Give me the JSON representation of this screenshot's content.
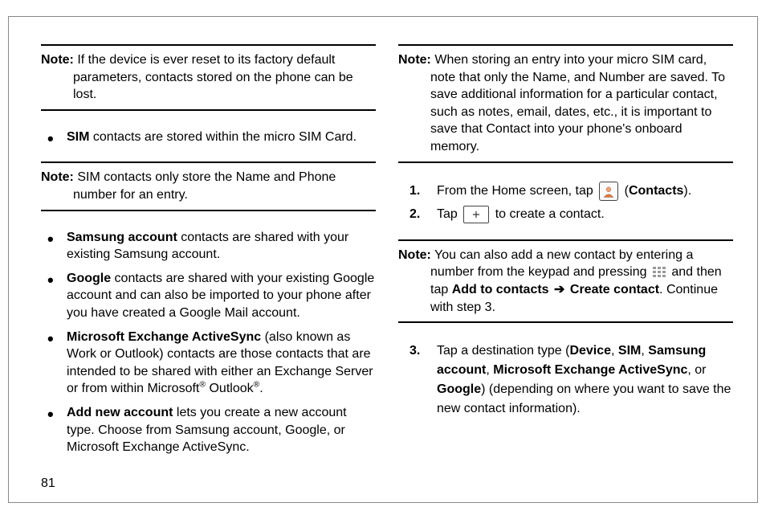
{
  "pageNumber": "81",
  "col1": {
    "note1": {
      "lead": "Note:",
      "body": " If the device is ever reset to its factory default parameters, contacts stored on the phone can be lost."
    },
    "ul1": {
      "sim_b": "SIM",
      "sim_t": " contacts are stored within the micro SIM Card."
    },
    "note2": {
      "lead": "Note:",
      "body": " SIM contacts only store the Name and Phone number for an entry."
    },
    "ul2": {
      "samsung_b": "Samsung account",
      "samsung_t": " contacts are shared with your existing Samsung account.",
      "google_b": "Google",
      "google_t": " contacts are shared with your existing Google account and can also be imported to your phone after you have created a Google Mail account.",
      "ms_b": "Microsoft Exchange ActiveSync",
      "ms_t1": " (also known as Work or Outlook) contacts are those contacts that are intended to be shared with either an Exchange Server or from within Microsoft",
      "ms_r1": "®",
      "ms_t2": " Outlook",
      "ms_r2": "®",
      "ms_t3": ".",
      "add_b": "Add new account",
      "add_t": " lets you create a new account type. Choose from Samsung account, Google, or Microsoft Exchange ActiveSync."
    }
  },
  "col2": {
    "note1": {
      "lead": "Note:",
      "body": " When storing an entry into your micro SIM card, note that only the Name, and Number are saved. To save additional information for a particular contact, such as notes, email, dates, etc., it is important to save that Contact into your phone's onboard memory."
    },
    "step1": {
      "num": "1.",
      "t1": "From the Home screen, tap ",
      "t2": " (",
      "b": "Contacts",
      "t3": ")."
    },
    "step2": {
      "num": "2.",
      "t1": "Tap ",
      "t2": " to create a contact."
    },
    "note2": {
      "lead": "Note:",
      "t1": " You can also add a new contact by entering a number from the keypad and pressing ",
      "t2": " and then tap ",
      "b1": "Add to contacts",
      "arrow": "➔",
      "b2": "Create contact",
      "t3": ". Continue with step 3."
    },
    "step3": {
      "num": "3.",
      "t1": "Tap a destination type (",
      "b1": "Device",
      "c": ", ",
      "b2": "SIM",
      "b3": "Samsung account",
      "b4": "Microsoft Exchange ActiveSync",
      "c_or": ", or ",
      "b5": "Google",
      "t2": ") (depending on where you want to save the new contact information)."
    }
  }
}
